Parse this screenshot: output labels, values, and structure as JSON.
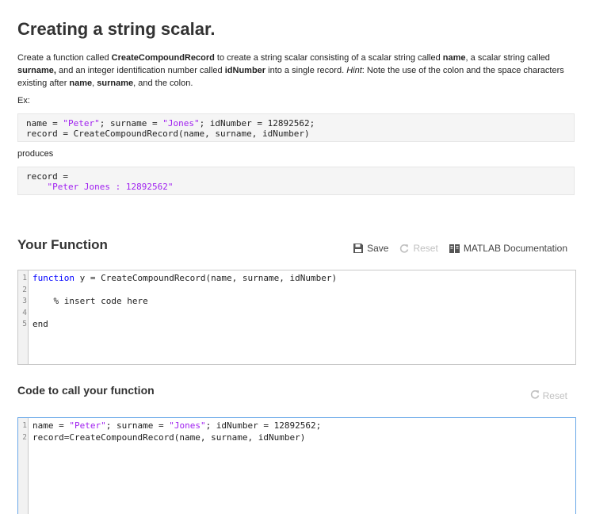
{
  "problem": {
    "title": "Creating a string scalar.",
    "description": {
      "p1": "Create a function called ",
      "b1": "CreateCompoundRecord",
      "p2": " to create a string scalar consisting of a scalar string called ",
      "b2": "name",
      "p3": ", a scalar string called ",
      "b3": "surname,",
      "p4": " and an integer identification number called ",
      "b4": "idNumber",
      "p5": " into a single record. ",
      "i1": "Hint",
      "p6": ": Note the use of the colon and the space characters existing after ",
      "b5": "name",
      "p7": ", ",
      "b6": "surname",
      "p8": ", and the colon."
    },
    "ex_label": "Ex:",
    "example": {
      "l1_a": "name = ",
      "l1_s1": "\"Peter\"",
      "l1_b": "; surname = ",
      "l1_s2": "\"Jones\"",
      "l1_c": "; idNumber = 12892562;",
      "l2": "record = CreateCompoundRecord(name, surname, idNumber)"
    },
    "produces_label": "produces",
    "output": {
      "l1": "record = ",
      "l2": "\"Peter Jones : 12892562\""
    }
  },
  "your_function": {
    "title": "Your Function",
    "toolbar": {
      "save_label": "Save",
      "reset_label": "Reset",
      "docs_label": "MATLAB Documentation"
    },
    "editor": {
      "line_numbers": [
        "1",
        "2",
        "3",
        "4",
        "5"
      ],
      "l1_kw": "function",
      "l1_rest": " y = CreateCompoundRecord(name, surname, idNumber)",
      "l3_comment": "    % insert code here",
      "l5_kw": "end"
    }
  },
  "call_function": {
    "title": "Code to call your function",
    "reset_label": "Reset",
    "editor": {
      "line_numbers": [
        "1",
        "2"
      ],
      "l1_a": "name = ",
      "l1_s1": "\"Peter\"",
      "l1_b": "; surname = ",
      "l1_s2": "\"Jones\"",
      "l1_c": "; idNumber = 12892562;",
      "l2": "record=CreateCompoundRecord(name, surname, idNumber)"
    }
  },
  "colors": {
    "string": "#a020f0",
    "keyword": "#0000ff",
    "comment": "#228b22",
    "focus_border": "#6aa8e8"
  }
}
